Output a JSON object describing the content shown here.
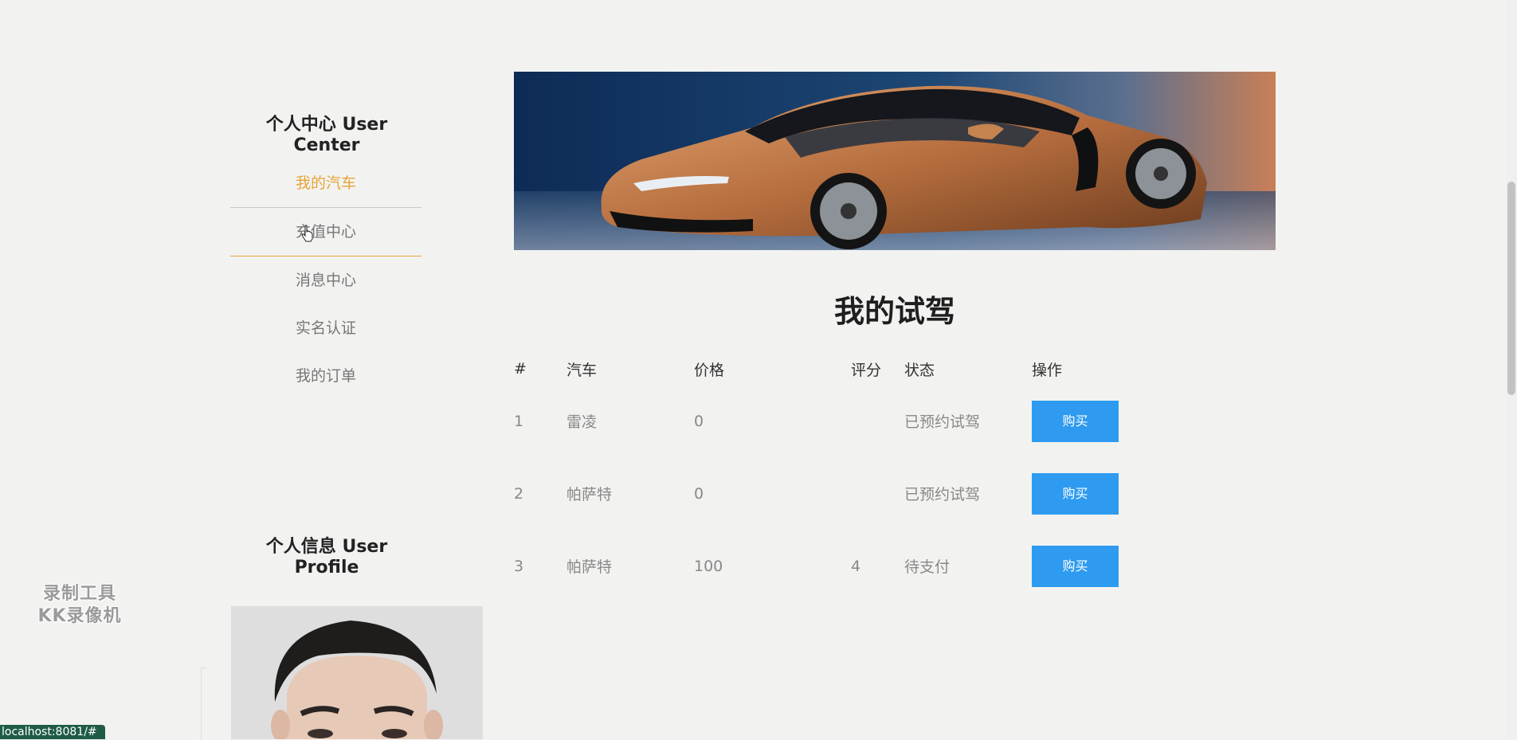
{
  "sidebar": {
    "title": "个人中心 User Center",
    "items": [
      {
        "label": "我的汽车",
        "active": true
      },
      {
        "label": "充值中心",
        "active": false
      },
      {
        "label": "消息中心",
        "active": false
      },
      {
        "label": "实名认证",
        "active": false
      },
      {
        "label": "我的订单",
        "active": false
      }
    ],
    "profile_title": "个人信息 User Profile"
  },
  "main": {
    "title": "我的试驾",
    "table": {
      "headers": [
        "#",
        "汽车",
        "价格",
        "评分",
        "状态",
        "操作"
      ],
      "rows": [
        {
          "id": "1",
          "car": "雷凌",
          "price": "0",
          "rating": "",
          "status": "已预约试驾",
          "action": "购买"
        },
        {
          "id": "2",
          "car": "帕萨特",
          "price": "0",
          "rating": "",
          "status": "已预约试驾",
          "action": "购买"
        },
        {
          "id": "3",
          "car": "帕萨特",
          "price": "100",
          "rating": "4",
          "status": "待支付",
          "action": "购买"
        }
      ]
    }
  },
  "watermark": {
    "line1": "录制工具",
    "line2": "KK录像机"
  },
  "status_url": "localhost:8081/#",
  "colors": {
    "accent": "#e8a437",
    "button": "#2e9bf0",
    "background": "#f2f3f1"
  }
}
